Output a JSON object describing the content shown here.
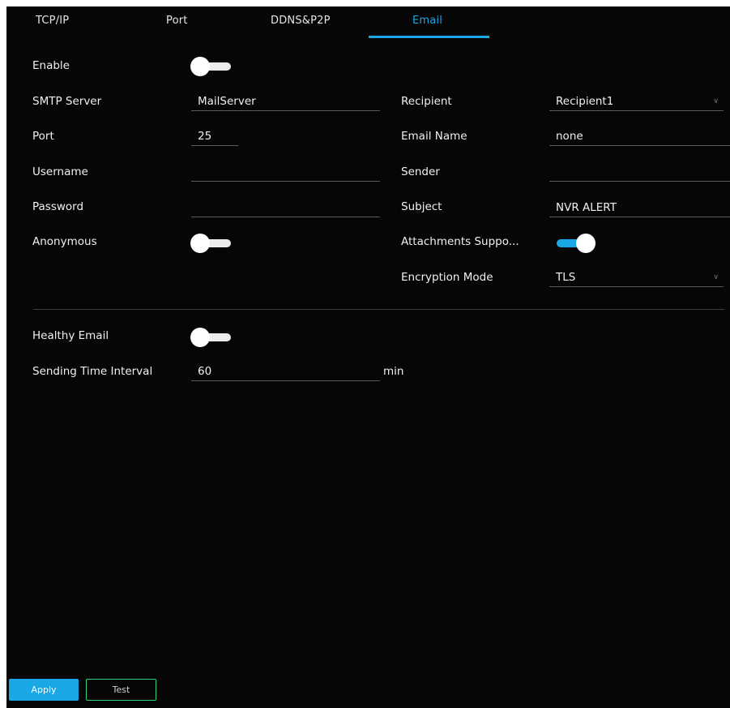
{
  "tabs": [
    {
      "label": "TCP/IP",
      "active": false
    },
    {
      "label": "Port",
      "active": false
    },
    {
      "label": "DDNS&P2P",
      "active": false
    },
    {
      "label": "Email",
      "active": true
    }
  ],
  "left": {
    "enable_label": "Enable",
    "enable_on": false,
    "smtp_label": "SMTP Server",
    "smtp_value": "MailServer",
    "port_label": "Port",
    "port_value": "25",
    "username_label": "Username",
    "username_value": "",
    "password_label": "Password",
    "password_value": "",
    "anonymous_label": "Anonymous",
    "anonymous_on": false
  },
  "right": {
    "recipient_label": "Recipient",
    "recipient_value": "Recipient1",
    "email_name_label": "Email Name",
    "email_name_value": "none",
    "sender_label": "Sender",
    "sender_value": "",
    "subject_label": "Subject",
    "subject_value": "NVR ALERT",
    "attachments_label": "Attachments Suppo...",
    "attachments_on": true,
    "encryption_label": "Encryption Mode",
    "encryption_value": "TLS"
  },
  "healthy": {
    "label": "Healthy Email",
    "on": false,
    "interval_label": "Sending Time Interval",
    "interval_value": "60",
    "interval_unit": "min"
  },
  "buttons": {
    "apply": "Apply",
    "test": "Test"
  },
  "icons": {
    "dropdown": "chevron-down-icon"
  },
  "colors": {
    "accent": "#1aa7e6",
    "background": "#060606",
    "test_border": "#2fd27a"
  }
}
